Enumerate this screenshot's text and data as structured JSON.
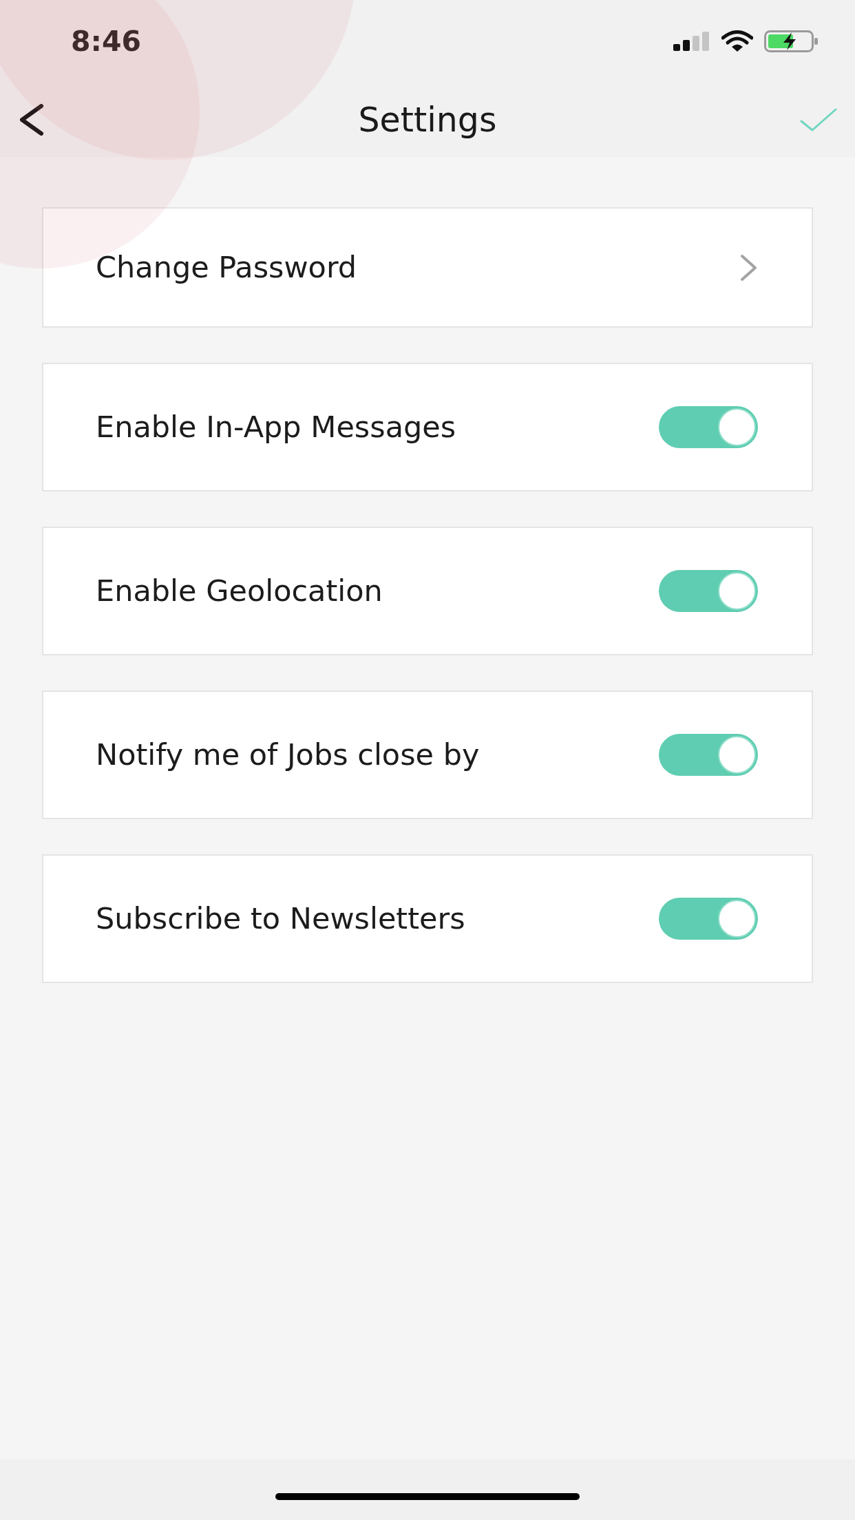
{
  "status_bar": {
    "time": "8:46"
  },
  "nav_bar": {
    "title": "Settings"
  },
  "settings": [
    {
      "kind": "link",
      "label": "Change Password"
    },
    {
      "kind": "toggle",
      "label": "Enable In-App Messages",
      "on": true
    },
    {
      "kind": "toggle",
      "label": "Enable Geolocation",
      "on": true
    },
    {
      "kind": "toggle",
      "label": "Notify me of Jobs close by",
      "on": true
    },
    {
      "kind": "toggle",
      "label": "Subscribe to Newsletters",
      "on": true
    }
  ]
}
